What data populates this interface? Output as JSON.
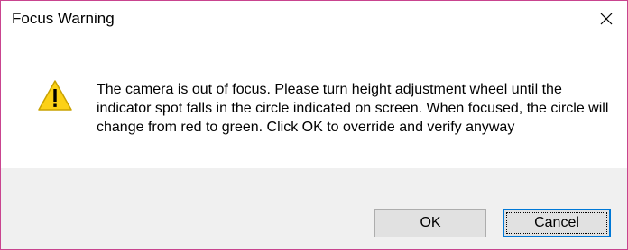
{
  "dialog": {
    "title": "Focus Warning",
    "close_icon": "close-icon",
    "warning_icon": "warning-triangle-icon",
    "message": "The camera is out of focus. Please turn height adjustment wheel until the indicator spot falls in the circle indicated on screen. When focused, the circle will change from red to green. Click OK to override and verify anyway",
    "ok_label": "OK",
    "cancel_label": "Cancel"
  },
  "colors": {
    "window_border": "#c9448f",
    "footer_background": "#f0f0f0",
    "button_background": "#e1e1e1",
    "default_button_border": "#0078d7",
    "warning_yellow": "#fcd116"
  }
}
